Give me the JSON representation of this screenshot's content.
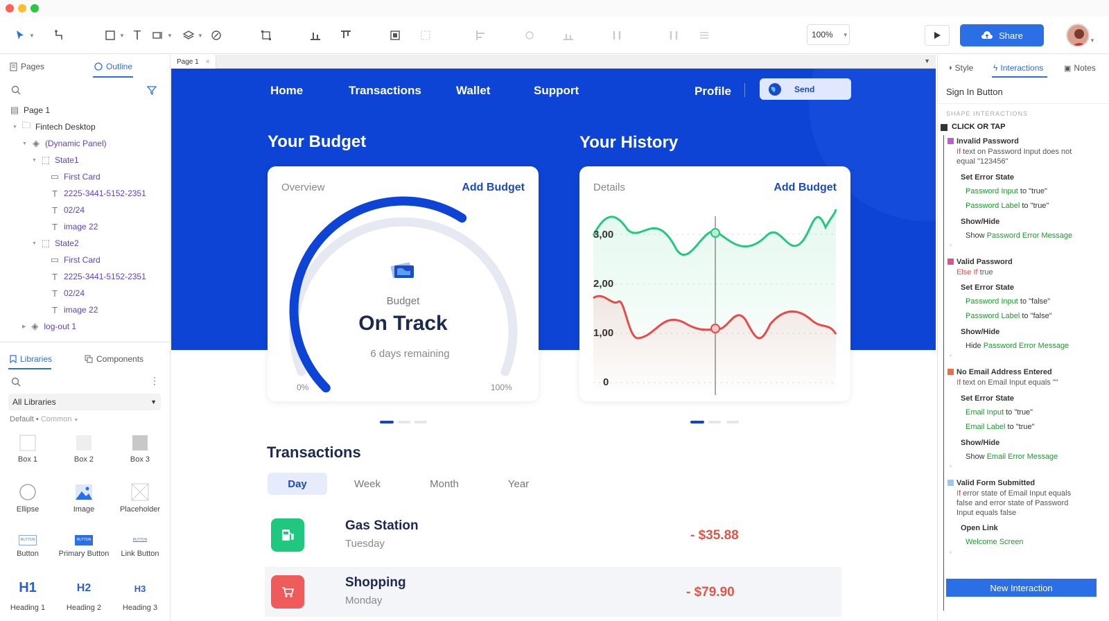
{
  "window": {
    "zoom": "100%",
    "share_label": "Share"
  },
  "left_panel": {
    "tabs": {
      "pages": "Pages",
      "outline": "Outline"
    },
    "tree": [
      {
        "label": "Page 1"
      },
      {
        "label": "Fintech Desktop"
      },
      {
        "label": "(Dynamic Panel)"
      },
      {
        "label": "State1"
      },
      {
        "label": "First Card"
      },
      {
        "label": "2225-3441-5152-2351"
      },
      {
        "label": "02/24"
      },
      {
        "label": "image 22"
      },
      {
        "label": "State2"
      },
      {
        "label": "First Card"
      },
      {
        "label": "2225-3441-5152-2351"
      },
      {
        "label": "02/24"
      },
      {
        "label": "image 22"
      },
      {
        "label": "log-out 1"
      }
    ],
    "lib_tabs": {
      "libraries": "Libraries",
      "components": "Components"
    },
    "library_select": "All Libraries",
    "library_filter": {
      "default": "Default",
      "common": "Common"
    },
    "items": [
      "Box 1",
      "Box 2",
      "Box 3",
      "Ellipse",
      "Image",
      "Placeholder",
      "Button",
      "Primary Button",
      "Link Button",
      "Heading 1",
      "Heading 2",
      "Heading 3"
    ],
    "heading_glyphs": [
      "H1",
      "H2",
      "H3"
    ],
    "button_glyph": "BUTTON"
  },
  "canvas": {
    "page_tab": "Page 1",
    "nav": [
      "Home",
      "Transactions",
      "Wallet",
      "Support"
    ],
    "profile": "Profile",
    "send": "Send",
    "budget_title": "Your Budget",
    "history_title": "Your History",
    "budget_card": {
      "head": "Overview",
      "link": "Add Budget",
      "label": "Budget",
      "status": "On Track",
      "remaining": "6 days remaining",
      "min": "0%",
      "max": "100%",
      "progress": 0.62
    },
    "history_card": {
      "head": "Details",
      "link": "Add Budget",
      "yticks": [
        "3,00",
        "2,00",
        "1,00",
        "0"
      ]
    },
    "transactions_title": "Transactions",
    "filters": [
      "Day",
      "Week",
      "Month",
      "Year"
    ],
    "transactions": [
      {
        "name": "Gas Station",
        "day": "Tuesday",
        "amount": "- $35.88"
      },
      {
        "name": "Shopping",
        "day": "Monday",
        "amount": "- $79.90"
      }
    ],
    "colors": {
      "hero": "#0d44d6",
      "gas_icon": "#20c77e",
      "shopping_icon": "#ef5b5b",
      "amount": "#e0574a"
    }
  },
  "right_panel": {
    "tabs": {
      "style": "Style",
      "interactions": "Interactions",
      "notes": "Notes"
    },
    "selected": "Sign In Button",
    "section": "SHAPE INTERACTIONS",
    "event": "CLICK OR TAP",
    "new_interaction": "New Interaction",
    "cases": {
      "c1_title": "Invalid Password",
      "c1_cond_kw": "If",
      "c1_cond_l1": " text on Password Input does not",
      "c1_cond_l2": "equal \"123456\"",
      "c1_a1": "Set Error State",
      "c1_a1_t1": "Password Input",
      "c1_a1_v1": " to \"true\"",
      "c1_a1_t2": "Password Label",
      "c1_a1_v2": " to \"true\"",
      "c1_a2": "Show/Hide",
      "c1_a2_verb": "Show ",
      "c1_a2_t": "Password Error Message",
      "c2_title": "Valid Password",
      "c2_cond_kw": "Else If",
      "c2_cond": " true",
      "c2_a1": "Set Error State",
      "c2_a1_t1": "Password Input",
      "c2_a1_v1": " to \"false\"",
      "c2_a1_t2": "Password Label",
      "c2_a1_v2": " to \"false\"",
      "c2_a2": "Show/Hide",
      "c2_a2_verb": "Hide ",
      "c2_a2_t": "Password Error Message",
      "c3_title": "No Email Address Entered",
      "c3_cond_kw": "If",
      "c3_cond": " text on Email Input equals \"\"",
      "c3_a1": "Set Error State",
      "c3_a1_t1": "Email Input",
      "c3_a1_v1": " to \"true\"",
      "c3_a1_t2": "Email Label",
      "c3_a1_v2": " to \"true\"",
      "c3_a2": "Show/Hide",
      "c3_a2_verb": "Show ",
      "c3_a2_t": "Email Error Message",
      "c4_title": "Valid Form Submitted",
      "c4_cond_kw": "If",
      "c4_cond_l1": " error state of Email Input equals",
      "c4_cond_l2": "false and error state of Password",
      "c4_cond_l3": "Input equals false",
      "c4_a1": "Open Link",
      "c4_a1_t": "Welcome Screen"
    }
  }
}
